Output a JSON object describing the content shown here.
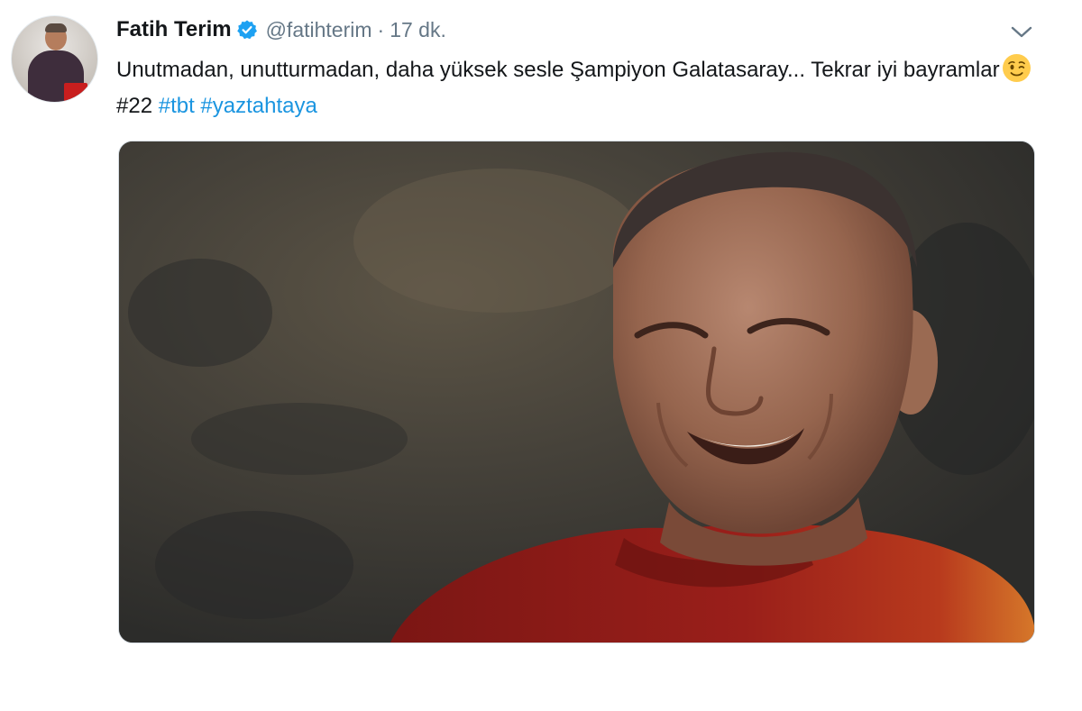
{
  "tweet": {
    "author_name": "Fatih Terim",
    "handle": "@fatihterim",
    "separator": "·",
    "time": "17 dk.",
    "text_main": "Unutmadan, unutturmadan, daha yüksek sesle Şampiyon Galatasaray... Tekrar iyi bayramlar",
    "hashtags": [
      "#22",
      "#tbt",
      "#yaztahtaya"
    ],
    "icons": {
      "verified": "verified-badge-icon",
      "more": "chevron-down-icon",
      "emoji": "winking-face-emoji"
    },
    "colors": {
      "link": "#1b95e0",
      "verified": "#1da1f2",
      "secondary_text": "#657786"
    }
  }
}
